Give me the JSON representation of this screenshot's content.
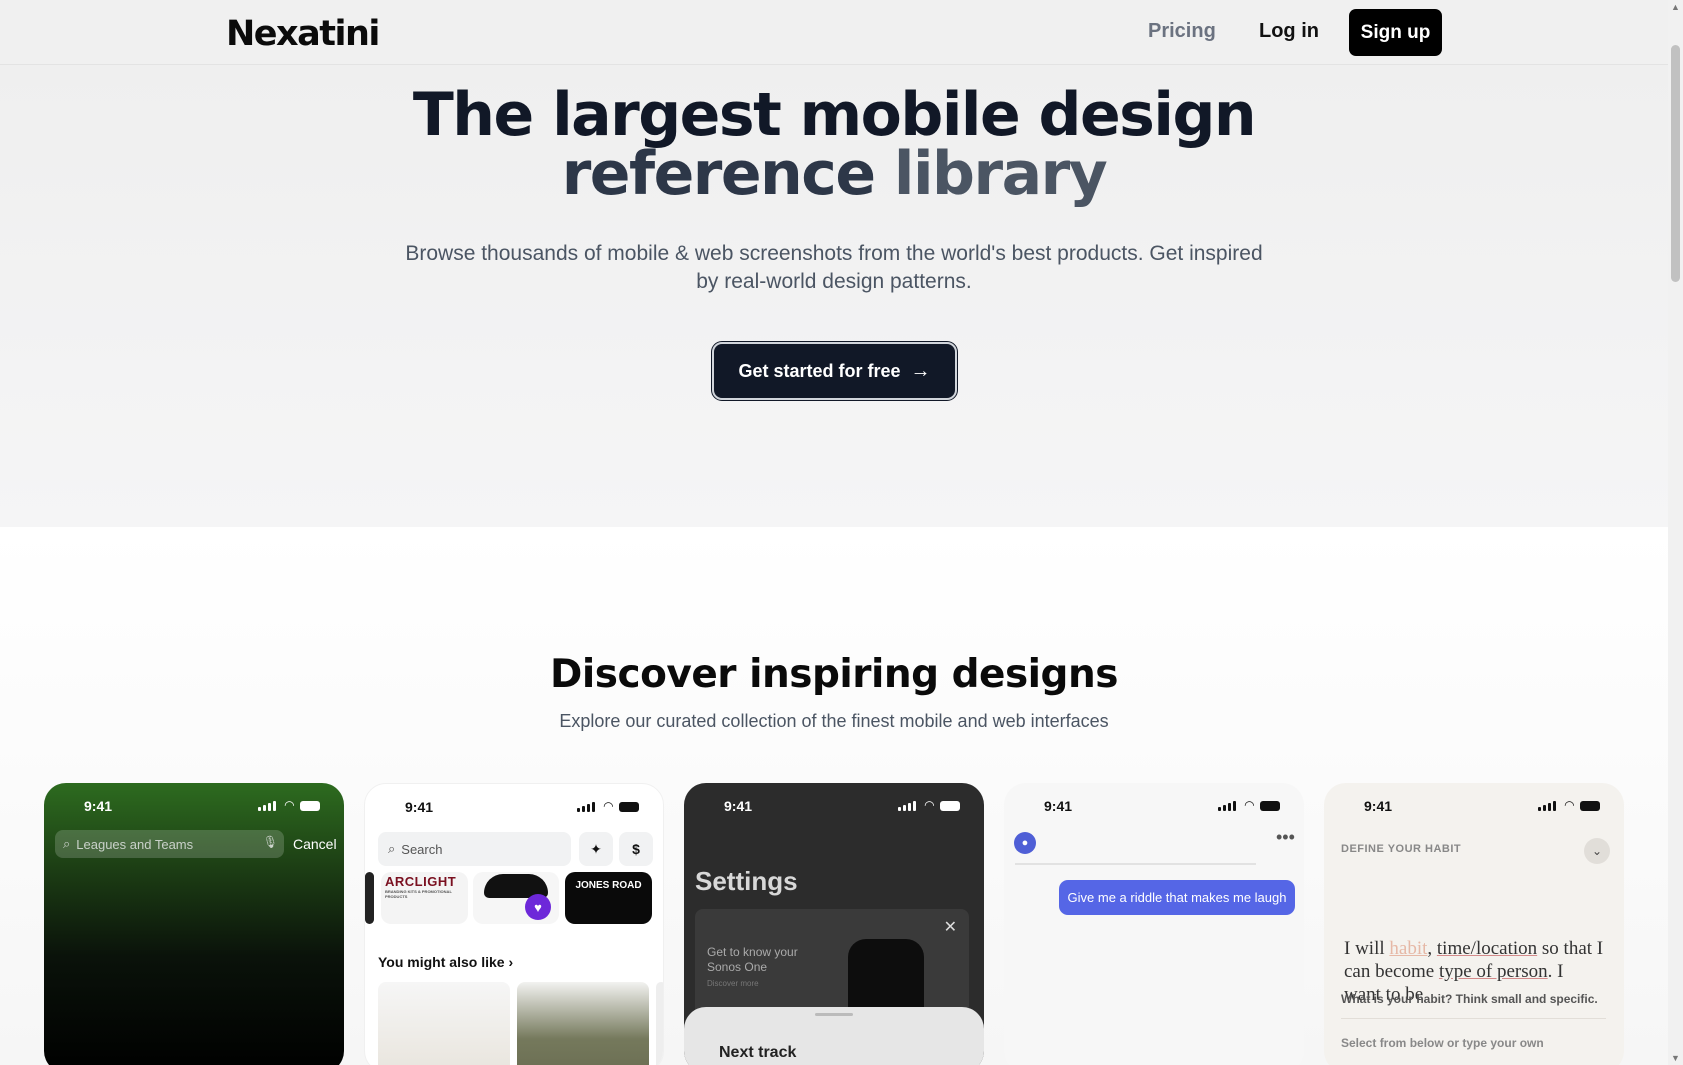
{
  "nav": {
    "logo": "Nexatini",
    "pricing": "Pricing",
    "login": "Log in",
    "signup": "Sign up"
  },
  "hero": {
    "title_line1": "The largest mobile design",
    "title_line2a": "reference ",
    "title_line2b": "library",
    "subtitle": "Browse thousands of mobile & web screenshots from the world's best products. Get inspired by real-world design patterns.",
    "cta": "Get started for free",
    "cta_icon": "arrow-right-icon"
  },
  "discover": {
    "title": "Discover inspiring designs",
    "subtitle": "Explore our curated collection of the finest mobile and web interfaces"
  },
  "cards": {
    "time": "9:41",
    "c1": {
      "search_placeholder": "Leagues and Teams",
      "cancel": "Cancel"
    },
    "c2": {
      "search_placeholder": "Search",
      "currency": "$",
      "brand1": "ARCLIGHT",
      "brand1_tagline": "BRANDING KITS & PROMOTIONAL PRODUCTS",
      "brand2": "JONES ROAD",
      "may_like": "You might also like"
    },
    "c3": {
      "title": "Settings",
      "panel_text1": "Get to know your",
      "panel_text2": "Sonos One",
      "panel_small": "Discover more",
      "next_track": "Next track"
    },
    "c4": {
      "message": "Give me a riddle that makes me laugh"
    },
    "c5": {
      "define": "DEFINE YOUR HABIT",
      "s_iwill": "I will ",
      "s_habit": "habit",
      "s_comma": ", ",
      "s_time": "time/location",
      "s_so": " so that I can become ",
      "s_type": "type of person",
      "s_want": ". I want to be",
      "overlay": "What is your habit? Think small and specific.",
      "select": "Select from below or type your own"
    }
  },
  "colors": {
    "accent": "#111827",
    "chat_bubble": "#5566e6",
    "heart": "#6d28d9"
  }
}
